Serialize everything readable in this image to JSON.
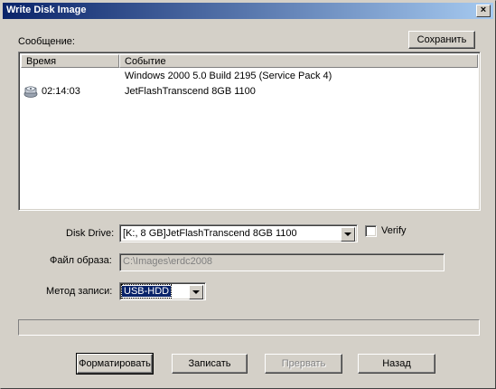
{
  "window": {
    "title": "Write Disk Image",
    "close_label": "×"
  },
  "message": {
    "label": "Сообщение:",
    "save_button": "Сохранить"
  },
  "log": {
    "columns": [
      "Время",
      "Событие"
    ],
    "rows": [
      {
        "icon": "disk-drive-icon",
        "time": "",
        "event": "Windows 2000 5.0 Build 2195 (Service Pack 4)"
      },
      {
        "icon": "disk-drive-icon",
        "time": "02:14:03",
        "event": "JetFlashTranscend 8GB   1100"
      }
    ]
  },
  "disk_drive": {
    "label": "Disk Drive:",
    "value": "[K:, 8 GB]JetFlashTranscend 8GB   1100"
  },
  "verify": {
    "label": "Verify",
    "checked": false
  },
  "image_file": {
    "label": "Файл образа:",
    "value": "C:\\Images\\erdc2008"
  },
  "write_method": {
    "label": "Метод записи:",
    "value": "USB-HDD"
  },
  "progress": {
    "value": 0
  },
  "buttons": {
    "format": "Форматировать",
    "write": "Записать",
    "abort": "Прервать",
    "back": "Назад"
  },
  "colors": {
    "titlebar_start": "#0a246a",
    "titlebar_end": "#a6caf0",
    "face": "#d4d0c8"
  }
}
